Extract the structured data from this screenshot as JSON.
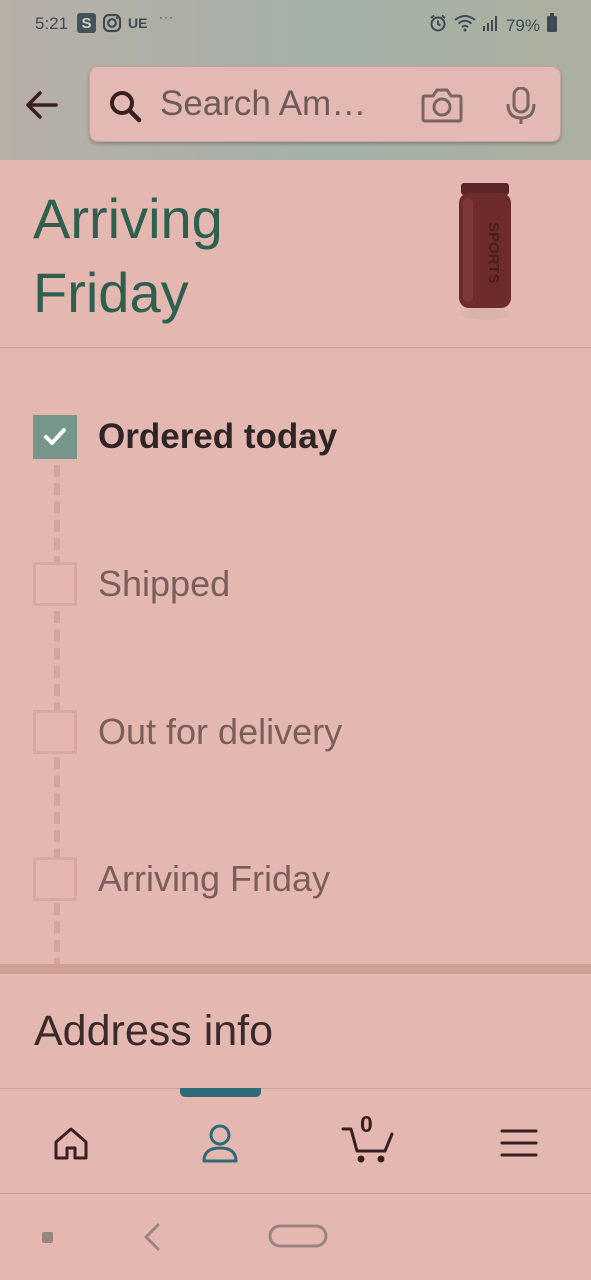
{
  "status_bar": {
    "time": "5:21",
    "app_s": "S",
    "app_ue": "UE",
    "more": "···",
    "battery": "79%"
  },
  "search": {
    "placeholder": "Search Amazon",
    "value": "Search Am…"
  },
  "order": {
    "title": "Arriving Friday",
    "product_text": "SPORTS"
  },
  "steps": [
    {
      "label": "Ordered today",
      "checked": true
    },
    {
      "label": "Shipped",
      "checked": false
    },
    {
      "label": "Out for delivery",
      "checked": false
    },
    {
      "label": "Arriving Friday",
      "checked": false
    }
  ],
  "address": {
    "heading": "Address info"
  },
  "bottom_nav": {
    "items": [
      {
        "name": "home",
        "icon": "home-icon"
      },
      {
        "name": "account",
        "icon": "person-icon",
        "active": true
      },
      {
        "name": "cart",
        "icon": "cart-icon",
        "count": "0"
      },
      {
        "name": "menu",
        "icon": "hamburger-menu-icon"
      }
    ]
  },
  "colors": {
    "background": "#e4b8b1",
    "title_green": "#2f5f4e",
    "check_green": "#76958b",
    "active_tab": "#2f6a78"
  }
}
